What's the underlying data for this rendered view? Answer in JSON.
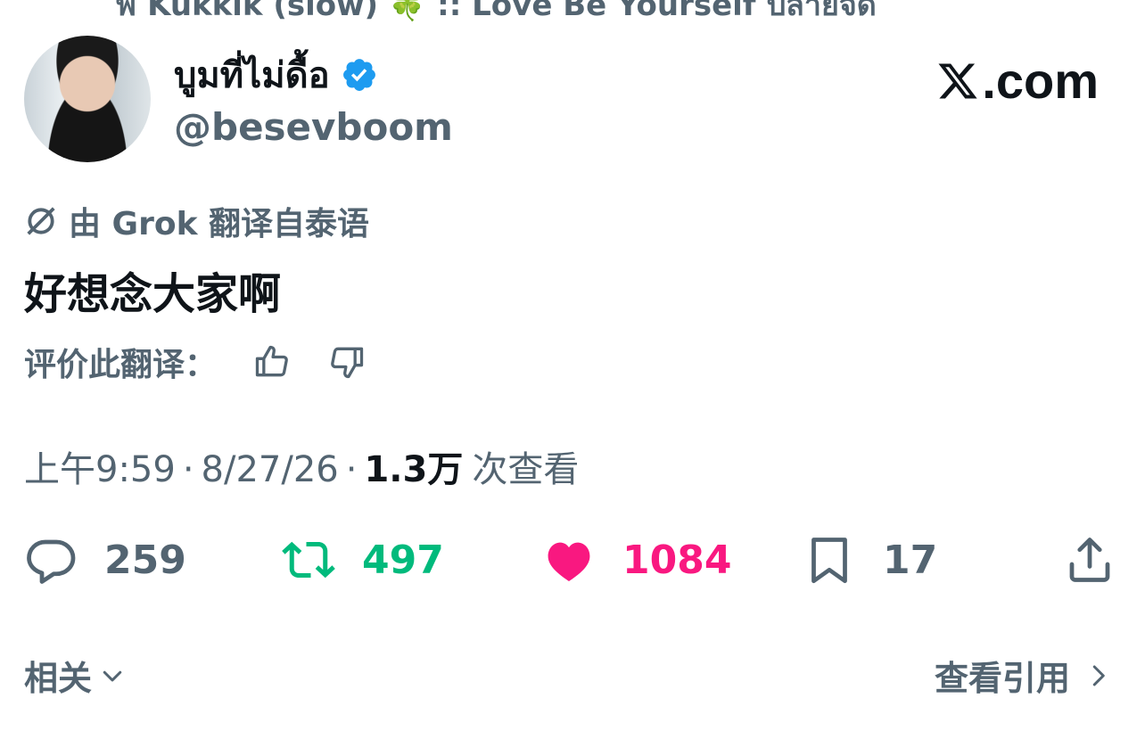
{
  "top_cropped": {
    "text": "ฬ Kukkik (slow) 🍀 :: Love Be Yourself ปลายจัด",
    "icon": "audio-icon"
  },
  "author": {
    "display_name": "บูมที่ไม่ดื้อ",
    "handle": "@besevboom",
    "verified_icon": "verified-badge-icon",
    "avatar": "avatar"
  },
  "brand": {
    "logo_text": ".com",
    "logo_icon": "x-logo-icon"
  },
  "translation": {
    "icon": "grok-icon",
    "label": "由 Grok 翻译自泰语"
  },
  "tweet": {
    "text": "好想念大家啊"
  },
  "rate": {
    "label": "评价此翻译：",
    "thumbs_up_icon": "thumbs-up-icon",
    "thumbs_down_icon": "thumbs-down-icon"
  },
  "meta": {
    "time": "上午9:59",
    "separator": "·",
    "date": "8/27/26",
    "views_count": "1.3万",
    "views_label": "次查看"
  },
  "actions": {
    "reply": {
      "icon": "reply-icon",
      "count": "259",
      "color": "#536471"
    },
    "repost": {
      "icon": "repost-icon",
      "count": "497",
      "color": "#00ba7c"
    },
    "like": {
      "icon": "heart-icon",
      "count": "1084",
      "color": "#f91880"
    },
    "bookmark": {
      "icon": "bookmark-icon",
      "count": "17",
      "color": "#536471"
    },
    "share": {
      "icon": "share-icon"
    }
  },
  "footer": {
    "related_label": "相关",
    "quotes_label": "查看引用"
  },
  "colors": {
    "secondary_text": "#536471",
    "primary_text": "#0f1419",
    "verified_blue": "#1d9bf0"
  }
}
